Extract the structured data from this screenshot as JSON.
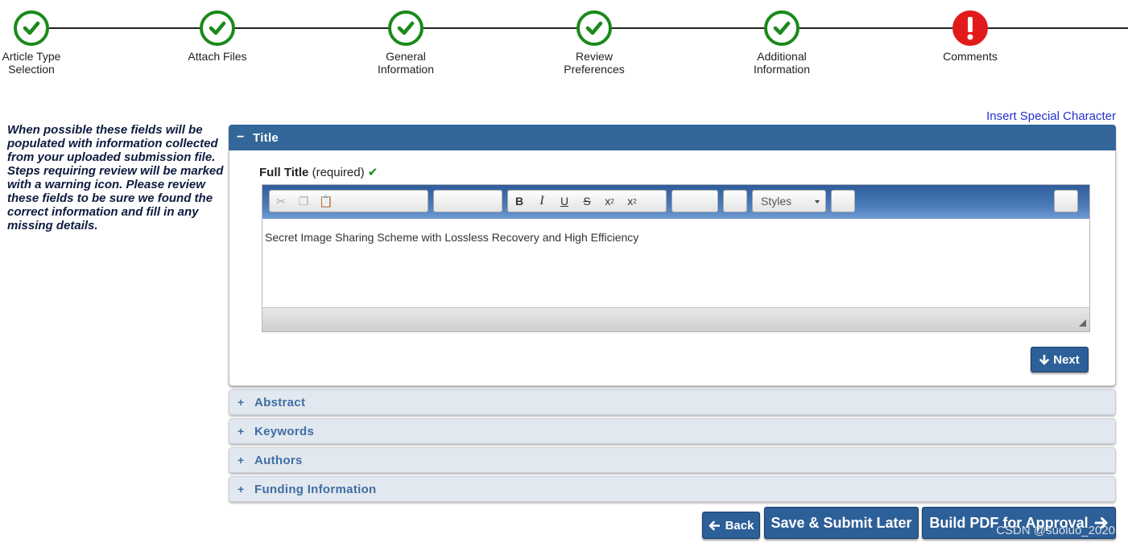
{
  "steps": [
    {
      "label_line1": "Article Type",
      "label_line2": "Selection",
      "status": "complete",
      "icon": "check-circle-icon"
    },
    {
      "label_line1": "Attach Files",
      "label_line2": "",
      "status": "complete",
      "icon": "check-circle-icon"
    },
    {
      "label_line1": "General",
      "label_line2": "Information",
      "status": "complete",
      "icon": "check-circle-icon"
    },
    {
      "label_line1": "Review",
      "label_line2": "Preferences",
      "status": "complete",
      "icon": "check-circle-icon"
    },
    {
      "label_line1": "Additional",
      "label_line2": "Information",
      "status": "complete",
      "icon": "check-circle-icon"
    },
    {
      "label_line1": "Comments",
      "label_line2": "",
      "status": "error",
      "icon": "exclamation-circle-icon"
    }
  ],
  "colors": {
    "complete": "#1a8a1a",
    "error": "#e11b1b",
    "header": "#336699",
    "button": "#2d5f98",
    "collapsed_bg": "#e2e8ef"
  },
  "note": "When possible these fields will be populated with information collected from your uploaded submission file. Steps requiring review will be marked with a warning icon. Please review these fields to be sure we found the correct information and fill in any missing details.",
  "special_char_link": "Insert Special Character",
  "title_panel": {
    "sign": "−",
    "title": "Title",
    "field_label": "Full Title",
    "required_text": "(required)",
    "check": "✔",
    "editor_value": "Secret Image Sharing Scheme with Lossless Recovery and High Efficiency",
    "styles_label": "Styles",
    "next_label": "Next"
  },
  "collapsed_panels": [
    {
      "sign": "+",
      "title": "Abstract"
    },
    {
      "sign": "+",
      "title": "Keywords"
    },
    {
      "sign": "+",
      "title": "Authors"
    },
    {
      "sign": "+",
      "title": "Funding Information"
    }
  ],
  "buttons": {
    "back": "Back",
    "save_later": "Save & Submit Later",
    "build_pdf": "Build PDF for Approval"
  },
  "watermark": "CSDN @suoluo_2020"
}
